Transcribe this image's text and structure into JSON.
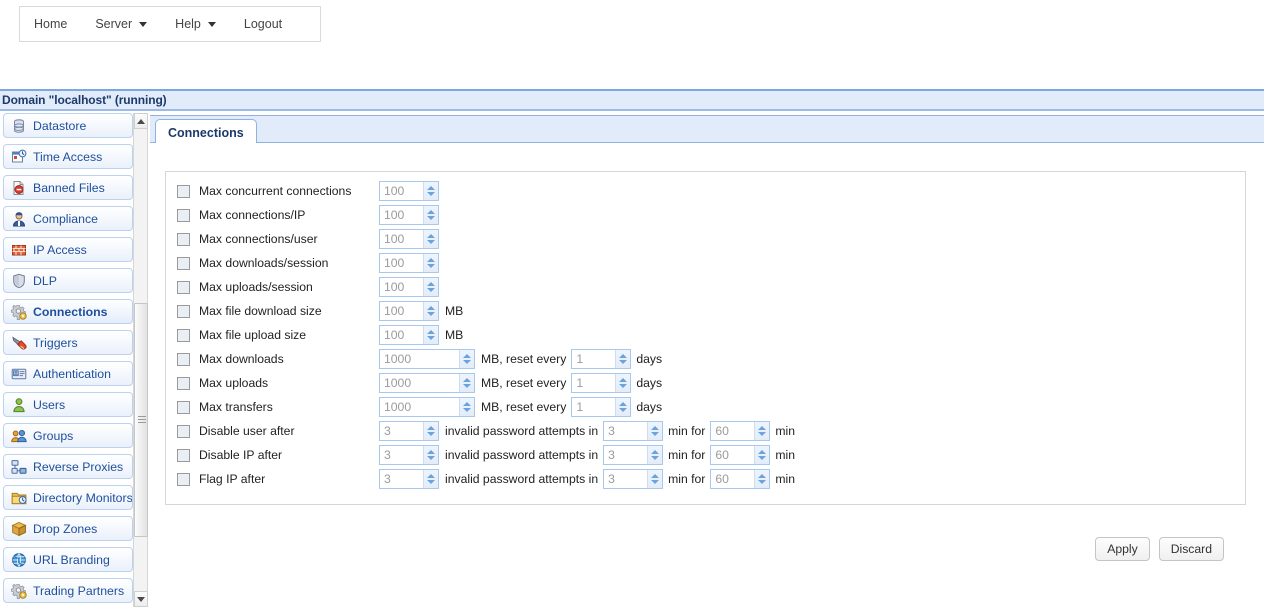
{
  "menubar": {
    "items": [
      {
        "label": "Home",
        "caret": false
      },
      {
        "label": "Server",
        "caret": true
      },
      {
        "label": "Help",
        "caret": true
      },
      {
        "label": "Logout",
        "caret": false
      }
    ]
  },
  "domain": {
    "title": "Domain \"localhost\" (running)"
  },
  "sidebar": {
    "items": [
      {
        "label": "Datastore",
        "icon": "database-icon",
        "active": false
      },
      {
        "label": "Time Access",
        "icon": "clock-calendar-icon",
        "active": false
      },
      {
        "label": "Banned Files",
        "icon": "banned-file-icon",
        "active": false
      },
      {
        "label": "Compliance",
        "icon": "officer-icon",
        "active": false
      },
      {
        "label": "IP Access",
        "icon": "firewall-icon",
        "active": false
      },
      {
        "label": "DLP",
        "icon": "shield-icon",
        "active": false
      },
      {
        "label": "Connections",
        "icon": "gears-icon",
        "active": true
      },
      {
        "label": "Triggers",
        "icon": "lightning-icon",
        "active": false
      },
      {
        "label": "Authentication",
        "icon": "id-card-icon",
        "active": false
      },
      {
        "label": "Users",
        "icon": "user-icon",
        "active": false
      },
      {
        "label": "Groups",
        "icon": "users-group-icon",
        "active": false
      },
      {
        "label": "Reverse Proxies",
        "icon": "network-nodes-icon",
        "active": false
      },
      {
        "label": "Directory Monitors",
        "icon": "folder-clock-icon",
        "active": false
      },
      {
        "label": "Drop Zones",
        "icon": "package-icon",
        "active": false
      },
      {
        "label": "URL Branding",
        "icon": "globe-icon",
        "active": false
      },
      {
        "label": "Trading Partners",
        "icon": "gears-icon",
        "active": false
      }
    ],
    "scrollbar": {
      "up": "scroll-up",
      "down": "scroll-down"
    }
  },
  "tabs": [
    {
      "label": "Connections",
      "active": true
    }
  ],
  "form": {
    "rows": [
      {
        "label": "Max concurrent connections",
        "v1": "100",
        "unit1": "",
        "v2": "",
        "unit2": "",
        "v3": "",
        "unit3": ""
      },
      {
        "label": "Max connections/IP",
        "v1": "100",
        "unit1": "",
        "v2": "",
        "unit2": "",
        "v3": "",
        "unit3": ""
      },
      {
        "label": "Max connections/user",
        "v1": "100",
        "unit1": "",
        "v2": "",
        "unit2": "",
        "v3": "",
        "unit3": ""
      },
      {
        "label": "Max downloads/session",
        "v1": "100",
        "unit1": "",
        "v2": "",
        "unit2": "",
        "v3": "",
        "unit3": ""
      },
      {
        "label": "Max uploads/session",
        "v1": "100",
        "unit1": "",
        "v2": "",
        "unit2": "",
        "v3": "",
        "unit3": ""
      },
      {
        "label": "Max file download size",
        "v1": "100",
        "unit1": "MB",
        "v2": "",
        "unit2": "",
        "v3": "",
        "unit3": ""
      },
      {
        "label": "Max file upload size",
        "v1": "100",
        "unit1": "MB",
        "v2": "",
        "unit2": "",
        "v3": "",
        "unit3": ""
      },
      {
        "label": "Max downloads",
        "v1": "1000",
        "unit1": "MB,  reset every",
        "v2": "1",
        "unit2": "days",
        "v3": "",
        "unit3": ""
      },
      {
        "label": "Max uploads",
        "v1": "1000",
        "unit1": "MB,  reset every",
        "v2": "1",
        "unit2": "days",
        "v3": "",
        "unit3": ""
      },
      {
        "label": "Max transfers",
        "v1": "1000",
        "unit1": "MB,  reset every",
        "v2": "1",
        "unit2": "days",
        "v3": "",
        "unit3": ""
      },
      {
        "label": "Disable user after",
        "v1": "3",
        "unit1": "invalid password attempts in",
        "v2": "3",
        "unit2": "min  for",
        "v3": "60",
        "unit3": "min"
      },
      {
        "label": "Disable IP after",
        "v1": "3",
        "unit1": "invalid password attempts in",
        "v2": "3",
        "unit2": "min  for",
        "v3": "60",
        "unit3": "min"
      },
      {
        "label": "Flag IP after",
        "v1": "3",
        "unit1": "invalid password attempts in",
        "v2": "3",
        "unit2": "min  for",
        "v3": "60",
        "unit3": "min"
      }
    ]
  },
  "footer": {
    "apply_label": "Apply",
    "discard_label": "Discard"
  },
  "colors": {
    "accent_blue": "#1f4f9c",
    "header_bg": "#e2ebfa",
    "header_border": "#7da7e0",
    "panel_border": "#d6d6d6",
    "spinner_border": "#a9c9ec",
    "spinner_chevron": "#6aa3dd",
    "value_text": "#9b9b9b"
  }
}
